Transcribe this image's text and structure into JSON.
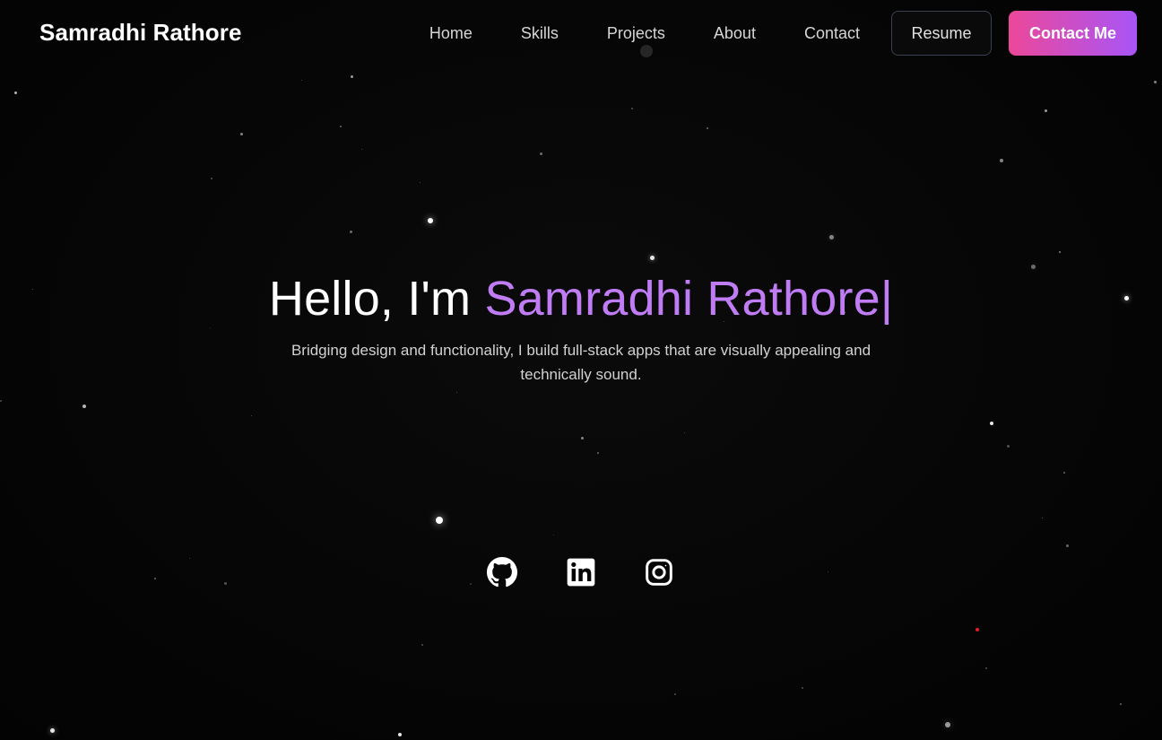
{
  "header": {
    "brand": "Samradhi Rathore",
    "nav": [
      "Home",
      "Skills",
      "Projects",
      "About",
      "Contact"
    ],
    "resume_label": "Resume",
    "contact_label": "Contact Me"
  },
  "hero": {
    "greeting": "Hello, I'm ",
    "name": "Samradhi Rathore",
    "cursor": "|",
    "subtitle": "Bridging design and functionality, I build full-stack apps that are visually appealing and technically sound."
  },
  "socials": [
    {
      "icon": "github-icon"
    },
    {
      "icon": "linkedin-icon"
    },
    {
      "icon": "instagram-icon"
    }
  ],
  "colors": {
    "accent": "#c07cf5",
    "gradient_start": "#ec4899",
    "gradient_end": "#a855f7",
    "background": "#050505"
  }
}
